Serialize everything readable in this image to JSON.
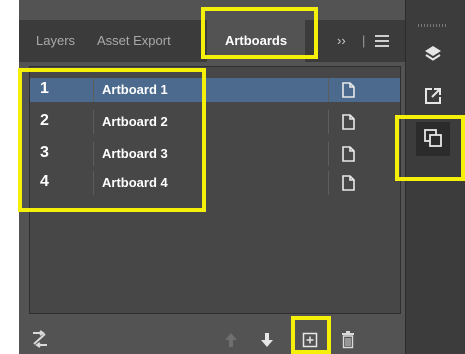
{
  "tabs": [
    {
      "label": "Layers",
      "active": false
    },
    {
      "label": "Asset Export",
      "active": false
    },
    {
      "label": "Artboards",
      "active": true
    }
  ],
  "tab_menu": {
    "overflow_label": "››",
    "divider": "|"
  },
  "artboards": [
    {
      "number": "1",
      "name": "Artboard 1",
      "selected": true
    },
    {
      "number": "2",
      "name": "Artboard 2",
      "selected": false
    },
    {
      "number": "3",
      "name": "Artboard 3",
      "selected": false
    },
    {
      "number": "4",
      "name": "Artboard 4",
      "selected": false
    }
  ],
  "bottom_toolbar": {
    "icons": [
      "rearrange-icon",
      "move-up-icon",
      "move-down-icon",
      "new-artboard-icon",
      "delete-icon"
    ]
  },
  "dock": {
    "icons": [
      "layers-icon",
      "asset-export-icon",
      "artboards-icon"
    ],
    "active": "artboards-icon"
  },
  "colors": {
    "panel_bg": "#535353",
    "tabbar_bg": "#3b3b3b",
    "selection": "#4b6a8e",
    "highlight": "#f4f00a"
  }
}
